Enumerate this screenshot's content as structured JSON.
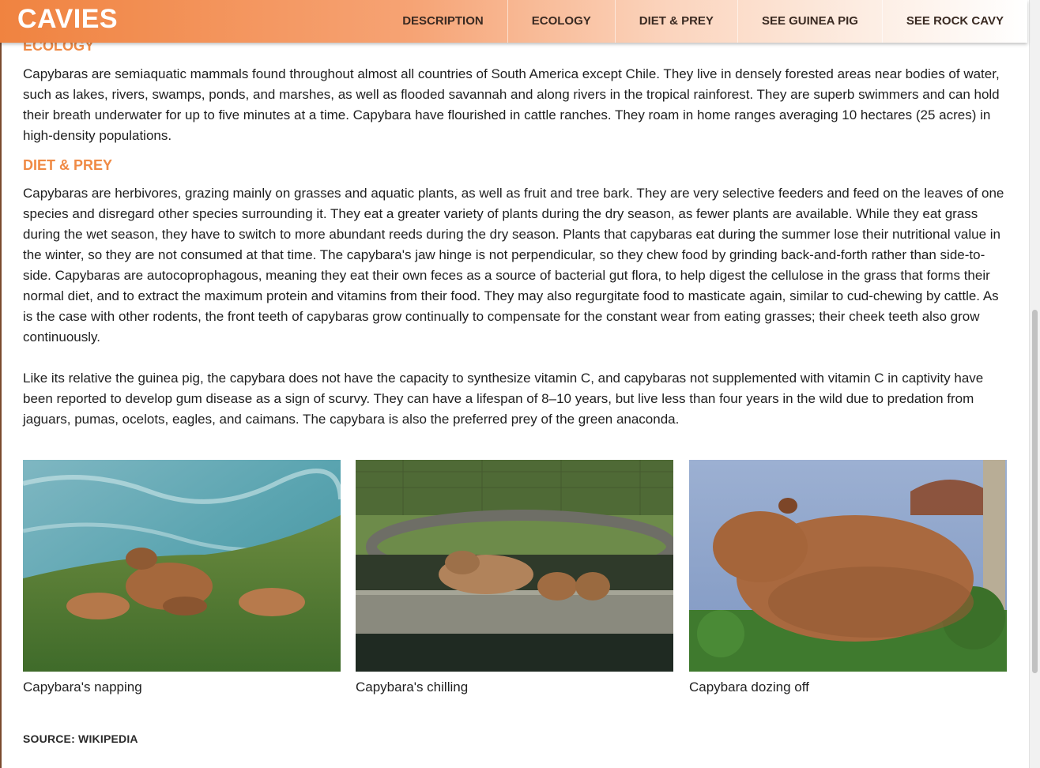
{
  "header": {
    "brand": "CAVIES",
    "nav": [
      {
        "label": "DESCRIPTION"
      },
      {
        "label": "ECOLOGY"
      },
      {
        "label": "DIET & PREY"
      },
      {
        "label": "SEE GUINEA PIG"
      },
      {
        "label": "SEE ROCK CAVY"
      }
    ]
  },
  "colors": {
    "accent": "#f08a45",
    "header_start": "#f08340",
    "text": "#1f1f1f"
  },
  "sections": {
    "ecology": {
      "heading": "ECOLOGY",
      "text": "Capybaras are semiaquatic mammals found throughout almost all countries of South America except Chile. They live in densely forested areas near bodies of water, such as lakes, rivers, swamps, ponds, and marshes, as well as flooded savannah and along rivers in the tropical rainforest. They are superb swimmers and can hold their breath underwater for up to five minutes at a time. Capybara have flourished in cattle ranches. They roam in home ranges averaging 10 hectares (25 acres) in high-density populations."
    },
    "diet": {
      "heading": "DIET & PREY",
      "text1": "Capybaras are herbivores, grazing mainly on grasses and aquatic plants, as well as fruit and tree bark. They are very selective feeders and feed on the leaves of one species and disregard other species surrounding it. They eat a greater variety of plants during the dry season, as fewer plants are available. While they eat grass during the wet season, they have to switch to more abundant reeds during the dry season. Plants that capybaras eat during the summer lose their nutritional value in the winter, so they are not consumed at that time. The capybara's jaw hinge is not perpendicular, so they chew food by grinding back-and-forth rather than side-to-side. Capybaras are autocoprophagous, meaning they eat their own feces as a source of bacterial gut flora, to help digest the cellulose in the grass that forms their normal diet, and to extract the maximum protein and vitamins from their food. They may also regurgitate food to masticate again, similar to cud-chewing by cattle. As is the case with other rodents, the front teeth of capybaras grow continually to compensate for the constant wear from eating grasses; their cheek teeth also grow continuously.",
      "text2": "Like its relative the guinea pig, the capybara does not have the capacity to synthesize vitamin C, and capybaras not supplemented with vitamin C in captivity have been reported to develop gum disease as a sign of scurvy. They can have a lifespan of 8–10 years, but live less than four years in the wild due to predation from jaguars, pumas, ocelots, eagles, and caimans. The capybara is also the preferred prey of the green anaconda."
    }
  },
  "gallery": [
    {
      "caption": "Capybara's napping"
    },
    {
      "caption": "Capybara's chilling"
    },
    {
      "caption": "Capybara dozing off"
    }
  ],
  "footer": {
    "source": "SOURCE: WIKIPEDIA"
  }
}
